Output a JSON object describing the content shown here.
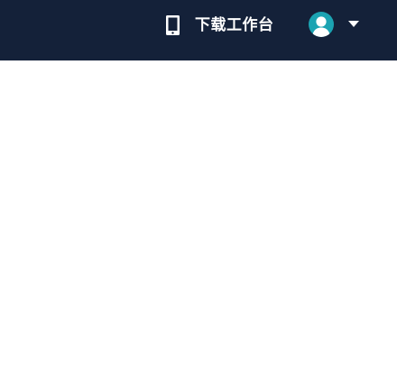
{
  "header": {
    "background": "#142139",
    "download_workbench": {
      "icon": "mobile-phone-icon",
      "label": "下载工作台"
    },
    "user_menu": {
      "avatar_icon": "user-avatar-icon",
      "avatar_color": "#1ba3b2",
      "dropdown_icon": "caret-down-icon"
    }
  }
}
